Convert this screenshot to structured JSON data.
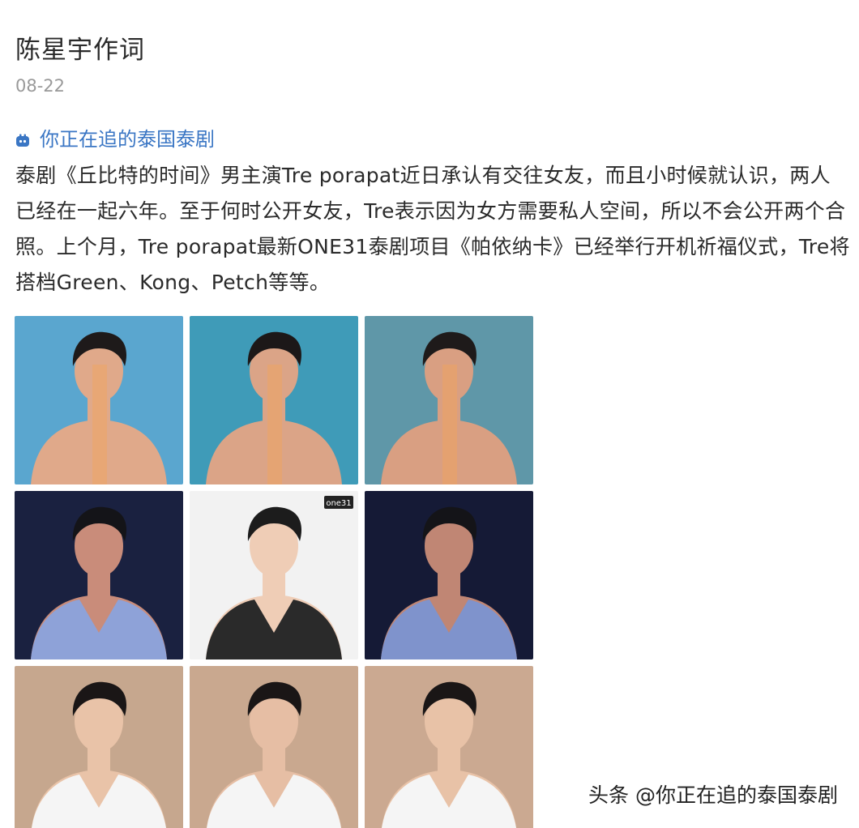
{
  "post": {
    "author": "陈星宇作词",
    "date": "08-22",
    "topic": "你正在追的泰国泰剧",
    "body": "泰剧《丘比特的时间》男主演Tre porapat近日承认有交往女友，而且小时候就认识，两人已经在一起六年。至于何时公开女友，Tre表示因为女方需要私人空间，所以不会公开两个合照。上个月，Tre porapat最新ONE31泰剧项目《帕依纳卡》已经举行开机祈福仪式，Tre将搭档Green、Kong、Petch等等。"
  },
  "colors": {
    "topic": "#3a76c4",
    "date": "#999999"
  },
  "photos": [
    {
      "bg": "#5aa6cf",
      "skin": "#e0a98a",
      "hair": "#1e1a1a",
      "top": null,
      "badge": ""
    },
    {
      "bg": "#3f9bb8",
      "skin": "#dba487",
      "hair": "#1c1818",
      "top": null,
      "badge": ""
    },
    {
      "bg": "#5f97a8",
      "skin": "#d99f82",
      "hair": "#1e1a1a",
      "top": null,
      "badge": ""
    },
    {
      "bg": "#1a2140",
      "skin": "#c98c7a",
      "hair": "#141418",
      "top": "#8ea2d8",
      "badge": ""
    },
    {
      "bg": "#f2f2f2",
      "skin": "#efcdb6",
      "hair": "#1c1c1c",
      "top": "#2a2a2a",
      "badge": "one31"
    },
    {
      "bg": "#151a36",
      "skin": "#c08674",
      "hair": "#141418",
      "top": "#7f93cc",
      "badge": ""
    },
    {
      "bg": "#c6a78e",
      "skin": "#e9c3a8",
      "hair": "#1a1616",
      "top": "#f5f5f5",
      "badge": ""
    },
    {
      "bg": "#c9a88f",
      "skin": "#e6bea4",
      "hair": "#1a1616",
      "top": "#f5f5f5",
      "badge": ""
    },
    {
      "bg": "#cba991",
      "skin": "#e8c2a7",
      "hair": "#1a1616",
      "top": "#f5f5f5",
      "badge": ""
    }
  ],
  "watermark": "头条 @你正在追的泰国泰剧"
}
